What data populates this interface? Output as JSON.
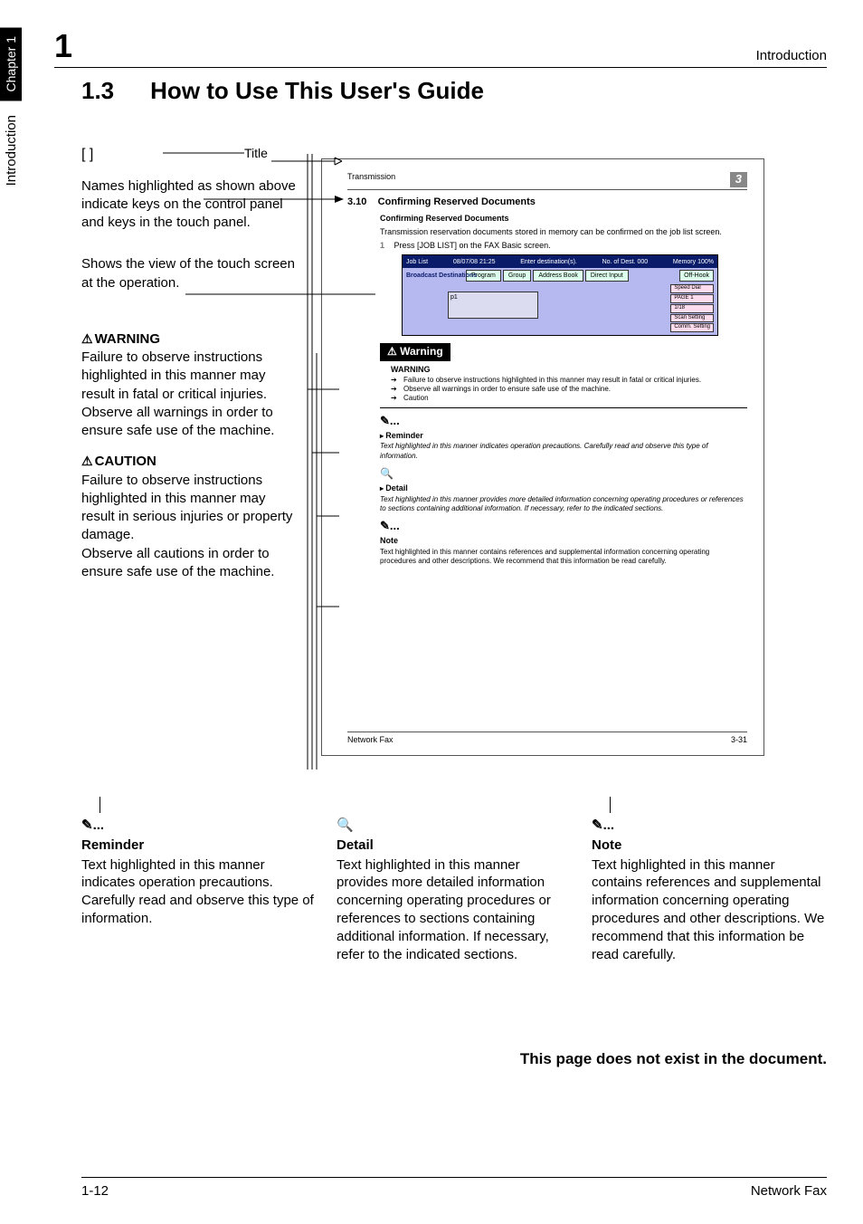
{
  "side": {
    "chapter": "Chapter 1",
    "section": "Introduction"
  },
  "topbar": {
    "num": "1",
    "section": "Introduction"
  },
  "heading": {
    "num": "1.3",
    "text": "How to Use This User's Guide"
  },
  "left": {
    "brackets": "[           ]",
    "title_label": "Title",
    "p1": "Names highlighted as shown above indicate keys on the control panel and keys in the touch panel.",
    "p2": "Shows the view of the touch screen at the operation.",
    "warn_head": "WARNING",
    "warn_body": "Failure to observe instructions highlighted in this manner may result in fatal or critical injuries. Observe all warnings in order to ensure safe use of the machine.",
    "caution_head": "CAUTION",
    "caution_body": "Failure to observe instructions highlighted in this manner may result in serious injuries or property damage.",
    "caution_body2": "Observe all cautions in order to ensure safe use of the machine."
  },
  "sample": {
    "header_left": "Transmission",
    "header_right": "3",
    "sec_num": "3.10",
    "sec_title": "Confirming Reserved Documents",
    "sub_title": "Confirming Reserved Documents",
    "body1": "Transmission reservation documents stored in memory can be confirmed on the job list screen.",
    "step_num": "1",
    "step_text": "Press [JOB LIST] on the FAX Basic screen.",
    "fax": {
      "top_job": "Job List",
      "top_date": "08/07/08 21:25",
      "top_enter": "Enter destination(s).",
      "top_mem": "Memory 100%",
      "top_dest_count": "No. of Dest. 000",
      "tab1": "Program",
      "tab2": "Group",
      "tab3": "Address Book",
      "tab4": "Direct Input",
      "offhook": "Off-Hook",
      "dest_label": "Broadcast Destinations",
      "slot": "p1",
      "btn1": "Speed Dial",
      "btn2": "PAGE 1",
      "btn3": "1/18",
      "btn4": "Scan Setting",
      "btn5": "Comm. Setting"
    },
    "warning_bar": "Warning",
    "warn_t": "WARNING",
    "warn_l1": "Failure to observe instructions highlighted in this manner may result in fatal or critical injuries.",
    "warn_l2": "Observe all warnings in order to ensure safe use of the machine.",
    "warn_l3": "Caution",
    "reminder_t": "Reminder",
    "reminder_b": "Text highlighted in this manner indicates operation precautions. Carefully read and observe this type of information.",
    "detail_t": "Detail",
    "detail_b": "Text highlighted in this manner provides more detailed information concerning operating procedures or references to sections containing additional information. If necessary, refer to the indicated sections.",
    "note_t": "Note",
    "note_b": "Text highlighted in this manner contains references and supplemental information concerning operating procedures and other descriptions. We recommend that this information be read carefully.",
    "footer_left": "Network Fax",
    "footer_right": "3-31"
  },
  "bottom": {
    "reminder_icon": "✎...",
    "reminder_h": "Reminder",
    "reminder_b": "Text highlighted in this manner indicates operation precautions. Carefully read and observe this type of information.",
    "detail_icon": "🔍",
    "detail_h": "Detail",
    "detail_b": "Text highlighted in this manner provides more detailed information concerning operating procedures or references to sections containing additional information. If necessary, refer to the indicated sections.",
    "note_icon": "✎...",
    "note_h": "Note",
    "note_b": "Text highlighted in this manner contains references and supplemental information concerning operating procedures and other descriptions. We recommend that this information be read carefully."
  },
  "nonexist": "This page does not exist in the document.",
  "footer": {
    "left": "1-12",
    "right": "Network Fax"
  }
}
